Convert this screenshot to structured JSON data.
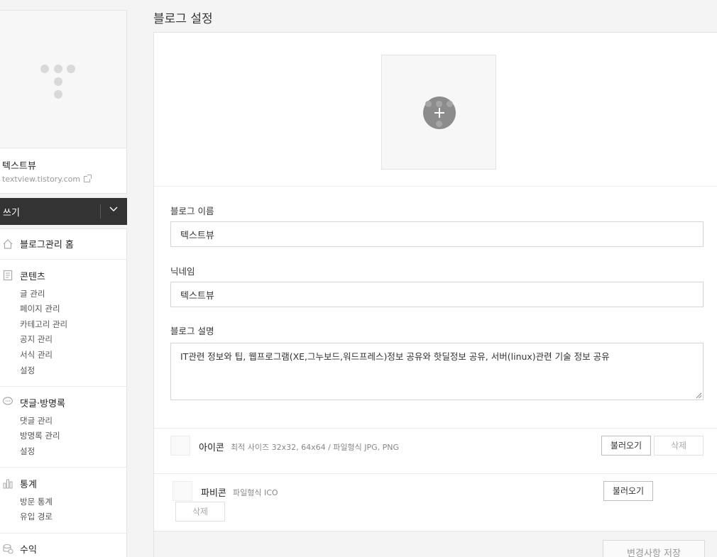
{
  "sidebar": {
    "blog_name": "텍스트뷰",
    "blog_url": "textview.tistory.com",
    "write_label": "쓰기",
    "home_label": "블로그관리 홈",
    "groups": [
      {
        "title": "콘텐츠",
        "icon": "document-icon",
        "items": [
          "글 관리",
          "페이지 관리",
          "카테고리 관리",
          "공지 관리",
          "서식 관리",
          "설정"
        ]
      },
      {
        "title": "댓글·방명록",
        "icon": "speech-bubble-icon",
        "items": [
          "댓글 관리",
          "방명록 관리",
          "설정"
        ]
      },
      {
        "title": "통계",
        "icon": "bar-chart-icon",
        "items": [
          "방문 통계",
          "유입 경로"
        ]
      },
      {
        "title": "수익",
        "icon": "coin-icon",
        "items": []
      }
    ]
  },
  "main": {
    "page_title": "블로그 설정",
    "blog_name_label": "블로그 이름",
    "blog_name_value": "텍스트뷰",
    "nickname_label": "닉네임",
    "nickname_value": "텍스트뷰",
    "description_label": "블로그 설명",
    "description_value": "IT관련 정보와 팁, 웹프로그램(XE,그누보드,워드프레스)정보 공유와 핫딜정보 공유, 서버(linux)관련 기술 정보 공유",
    "icon_row": {
      "title": "아이콘",
      "desc": "최적 사이즈 32x32, 64x64 / 파일형식 JPG, PNG",
      "load_label": "불러오기",
      "delete_label": "삭제"
    },
    "favicon_row": {
      "title": "파비콘",
      "desc": "파일형식 ICO",
      "load_label": "불러오기",
      "delete_label": "삭제"
    },
    "save_label": "변경사항 저장"
  },
  "colors": {
    "dark_bar": "#333333",
    "accent_gray": "#8c8c8c"
  }
}
